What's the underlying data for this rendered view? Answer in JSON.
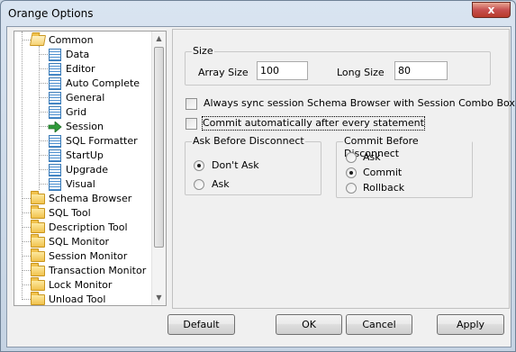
{
  "window": {
    "title": "Orange Options",
    "close_glyph": "x"
  },
  "tree": {
    "items": [
      {
        "label": "Common",
        "icon": "folder-open-icon"
      },
      {
        "label": "Data",
        "icon": "document-icon"
      },
      {
        "label": "Editor",
        "icon": "document-icon"
      },
      {
        "label": "Auto Complete",
        "icon": "document-icon"
      },
      {
        "label": "General",
        "icon": "document-icon"
      },
      {
        "label": "Grid",
        "icon": "document-icon"
      },
      {
        "label": "Session",
        "icon": "green-arrow-icon"
      },
      {
        "label": "SQL Formatter",
        "icon": "document-icon"
      },
      {
        "label": "StartUp",
        "icon": "document-icon"
      },
      {
        "label": "Upgrade",
        "icon": "document-icon"
      },
      {
        "label": "Visual",
        "icon": "document-icon"
      },
      {
        "label": "Schema Browser",
        "icon": "folder-icon"
      },
      {
        "label": "SQL Tool",
        "icon": "folder-icon"
      },
      {
        "label": "Description Tool",
        "icon": "folder-icon"
      },
      {
        "label": "SQL Monitor",
        "icon": "folder-icon"
      },
      {
        "label": "Session Monitor",
        "icon": "folder-icon"
      },
      {
        "label": "Transaction Monitor",
        "icon": "folder-icon"
      },
      {
        "label": "Lock Monitor",
        "icon": "folder-icon"
      },
      {
        "label": "Unload Tool",
        "icon": "folder-icon"
      }
    ]
  },
  "size_group": {
    "legend": "Size",
    "array_size_label": "Array Size",
    "array_size_value": "100",
    "long_size_label": "Long Size",
    "long_size_value": "80"
  },
  "options": {
    "always_sync_label": "Always sync session Schema Browser with Session Combo Box.",
    "always_sync_checked": false,
    "commit_auto_label": "Commit automatically after every statement",
    "commit_auto_checked": false
  },
  "ask_before_disconnect": {
    "legend": "Ask Before Disconnect",
    "options": [
      "Don't Ask",
      "Ask"
    ],
    "selected": "Don't Ask"
  },
  "commit_before_disconnect": {
    "legend": "Commit Before Disconnect",
    "options": [
      "Ask",
      "Commit",
      "Rollback"
    ],
    "selected": "Commit"
  },
  "buttons": {
    "default_label": "Default",
    "ok_label": "OK",
    "cancel_label": "Cancel",
    "apply_label": "Apply"
  }
}
